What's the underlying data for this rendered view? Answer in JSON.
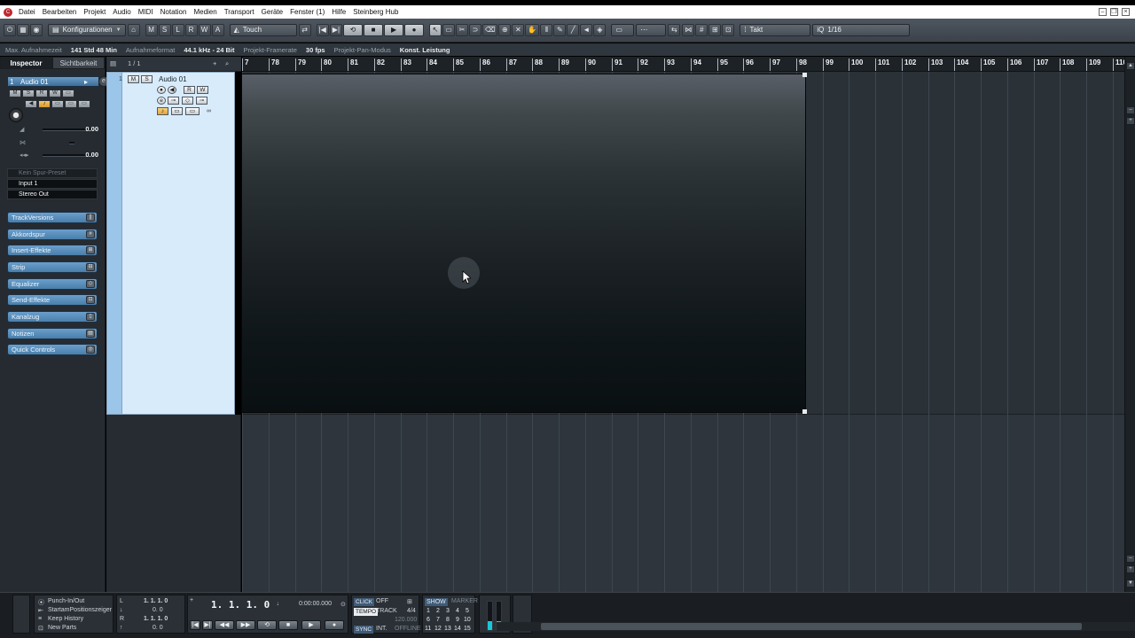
{
  "menubar": {
    "items": [
      "Datei",
      "Bearbeiten",
      "Projekt",
      "Audio",
      "MIDI",
      "Notation",
      "Medien",
      "Transport",
      "Geräte",
      "Fenster (1)",
      "Hilfe",
      "Steinberg Hub"
    ]
  },
  "toolbar": {
    "config_label": "Konfigurationen",
    "mode_buttons": [
      "M",
      "S",
      "L",
      "R",
      "W",
      "A"
    ],
    "automation_mode": "Touch",
    "grid_type": "Takt",
    "quantize": "1/16"
  },
  "statusline": {
    "max_rec_label": "Max. Aufnahmezeit",
    "max_rec_value": "141 Std 48 Min",
    "rec_format_label": "Aufnahmeformat",
    "rec_format_value": "44.1 kHz - 24 Bit",
    "framerate_label": "Projekt-Framerate",
    "framerate_value": "30 fps",
    "pan_mode_label": "Projekt-Pan-Modus",
    "pan_mode_value": "Konst. Leistung"
  },
  "inspector": {
    "tab_inspector": "Inspector",
    "tab_visibility": "Sichtbarkeit",
    "track_number": "1",
    "track_name": "Audio 01",
    "volume_value": "0.00",
    "pan_value": "0.00",
    "preset_placeholder": "Kein Spur-Preset",
    "input": "Input 1",
    "output": "Stereo Out",
    "sections": [
      "TrackVersions",
      "Akkordspur",
      "Insert-Effekte",
      "Strip",
      "Equalizer",
      "Send-Effekte",
      "Kanalzug",
      "Notizen",
      "Quick Controls"
    ]
  },
  "tracklist": {
    "count": "1 / 1",
    "track_number": "1",
    "track_name": "Audio 01",
    "btn_m": "M",
    "btn_s": "S",
    "btn_r": "R",
    "btn_w": "W"
  },
  "ruler": {
    "bars": [
      "7",
      "78",
      "79",
      "80",
      "81",
      "82",
      "83",
      "84",
      "85",
      "86",
      "87",
      "88",
      "89",
      "90",
      "91",
      "92",
      "93",
      "94",
      "95",
      "96",
      "97",
      "98",
      "99",
      "100",
      "101",
      "102",
      "103",
      "104",
      "105",
      "106",
      "107",
      "108",
      "109",
      "110"
    ]
  },
  "transport": {
    "punch_label": "Punch-In/Out",
    "start_pos_label": "StartamPositionszeiger",
    "keep_history_label": "Keep History",
    "new_parts_label": "New Parts",
    "locator_left": "1. 1. 1.   0",
    "locator_right": "1. 1. 1.   0",
    "locator_zero": "0.      0",
    "position_bars": "1.  1.  1.    0",
    "position_time": "0:00:00.000",
    "click_label": "CLICK",
    "click_value": "OFF",
    "tempo_label": "TEMPO",
    "tempo_mode": "TRACK",
    "signature": "4/4",
    "tempo_value": "120.000",
    "sync_label": "SYNC",
    "sync_mode": "INT.",
    "sync_status": "OFFLINE",
    "show_label": "SHOW",
    "marker_label": "MARKER",
    "marker_numbers": [
      "1",
      "2",
      "3",
      "4",
      "5",
      "6",
      "7",
      "8",
      "9",
      "10",
      "11",
      "12",
      "13",
      "14",
      "15"
    ]
  },
  "colors": {
    "track_color": "#9bc6ea",
    "meter_fill": "#16c8d8",
    "app_accent": "#c0272d"
  }
}
